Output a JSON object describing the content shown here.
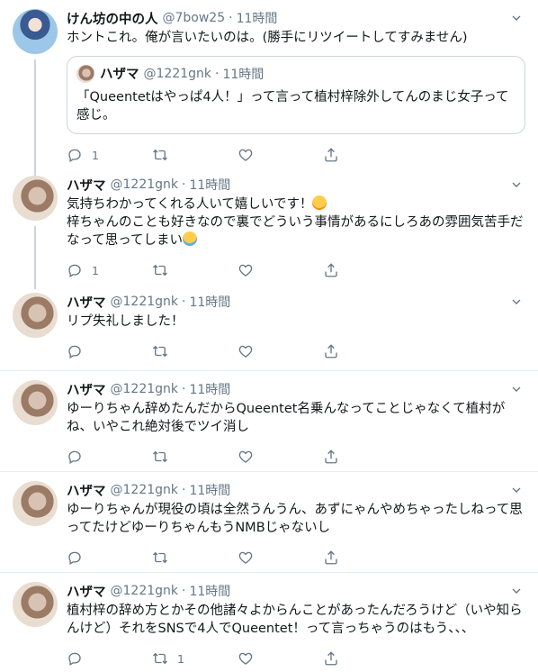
{
  "tweets": [
    {
      "name": "けん坊の中の人",
      "handle": "@7bow25",
      "time": "11時間",
      "text": "ホントこれ。俺が言いたいのは。(勝手にリツイートしてすみません)",
      "quote": {
        "name": "ハザマ",
        "handle": "@1221gnk",
        "time": "11時間",
        "text": "「Queentetはやっぱ4人！」って言って植村梓除外してんのまじ女子って感じ。"
      },
      "reply_count": "1",
      "retweet_count": "",
      "like_count": ""
    },
    {
      "name": "ハザマ",
      "handle": "@1221gnk",
      "time": "11時間",
      "text_line1": "気持ちわかってくれる人いて嬉しいです！",
      "text_line2": "梓ちゃんのことも好きなので裏でどういう事情があるにしろあの雰囲気苦手だなって思ってしまい",
      "reply_count": "1",
      "retweet_count": "",
      "like_count": ""
    },
    {
      "name": "ハザマ",
      "handle": "@1221gnk",
      "time": "11時間",
      "text": "リプ失礼しました！",
      "reply_count": "",
      "retweet_count": "",
      "like_count": ""
    },
    {
      "name": "ハザマ",
      "handle": "@1221gnk",
      "time": "11時間",
      "text": "ゆーりちゃん辞めたんだからQueentet名乗んなってことじゃなくて植村がね、いやこれ絶対後でツイ消し",
      "reply_count": "",
      "retweet_count": "",
      "like_count": ""
    },
    {
      "name": "ハザマ",
      "handle": "@1221gnk",
      "time": "11時間",
      "text": "ゆーりちゃんが現役の頃は全然うんうん、あずにゃんやめちゃったしねって思ってたけどゆーりちゃんもうNMBじゃないし",
      "reply_count": "",
      "retweet_count": "",
      "like_count": ""
    },
    {
      "name": "ハザマ",
      "handle": "@1221gnk",
      "time": "11時間",
      "text": "植村梓の辞め方とかその他諸々よからんことがあったんだろうけど（いや知らんけど）それをSNSで4人でQueentet！って言っちゃうのはもう、、、",
      "reply_count": "",
      "retweet_count": "1",
      "like_count": ""
    }
  ],
  "dot": "·",
  "icons": {
    "reply": "reply-icon",
    "retweet": "retweet-icon",
    "like": "heart-icon",
    "share": "share-icon",
    "caret": "chevron-down-icon"
  },
  "colors": {
    "muted": "#657786",
    "border": "#e6ecf0",
    "thread": "#ccd6dd"
  }
}
